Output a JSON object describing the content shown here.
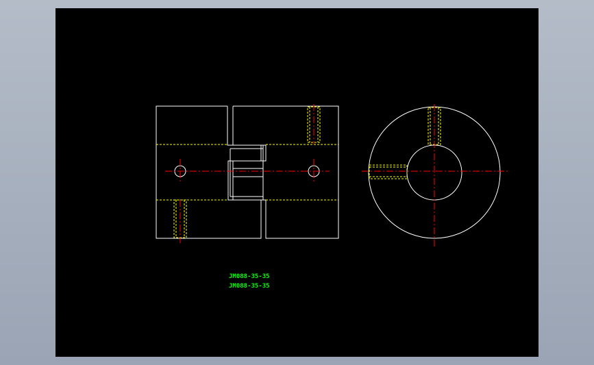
{
  "colors": {
    "background": "#9aa4b4",
    "sheet": "#000000",
    "outline": "#ffffff",
    "hidden_line": "#ffff00",
    "center_line": "#ff0000",
    "annotation": "#00ff00"
  },
  "annotations": {
    "line1": "JM088-35-35",
    "line2": "JM088-35-35"
  }
}
